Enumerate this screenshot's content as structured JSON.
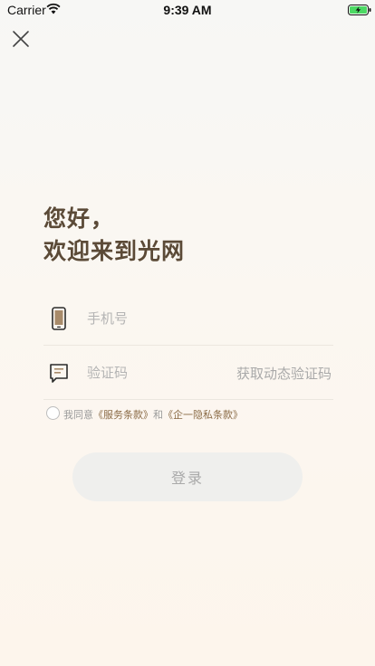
{
  "status_bar": {
    "carrier": "Carrier",
    "time": "9:39 AM"
  },
  "greeting": {
    "line1": "您好，",
    "line2": "欢迎来到光网"
  },
  "phone": {
    "placeholder": "手机号"
  },
  "code": {
    "placeholder": "验证码",
    "get_code_label": "获取动态验证码"
  },
  "agreement": {
    "prefix": "我同意",
    "terms_link": "《服务条款》",
    "conjunction": "和",
    "privacy_link": "《企一隐私条款》"
  },
  "login": {
    "label": "登录"
  },
  "colors": {
    "accent": "#5b4a37",
    "link": "#8a6a45",
    "button_bg": "#efefed",
    "battery_green": "#4cd964"
  }
}
